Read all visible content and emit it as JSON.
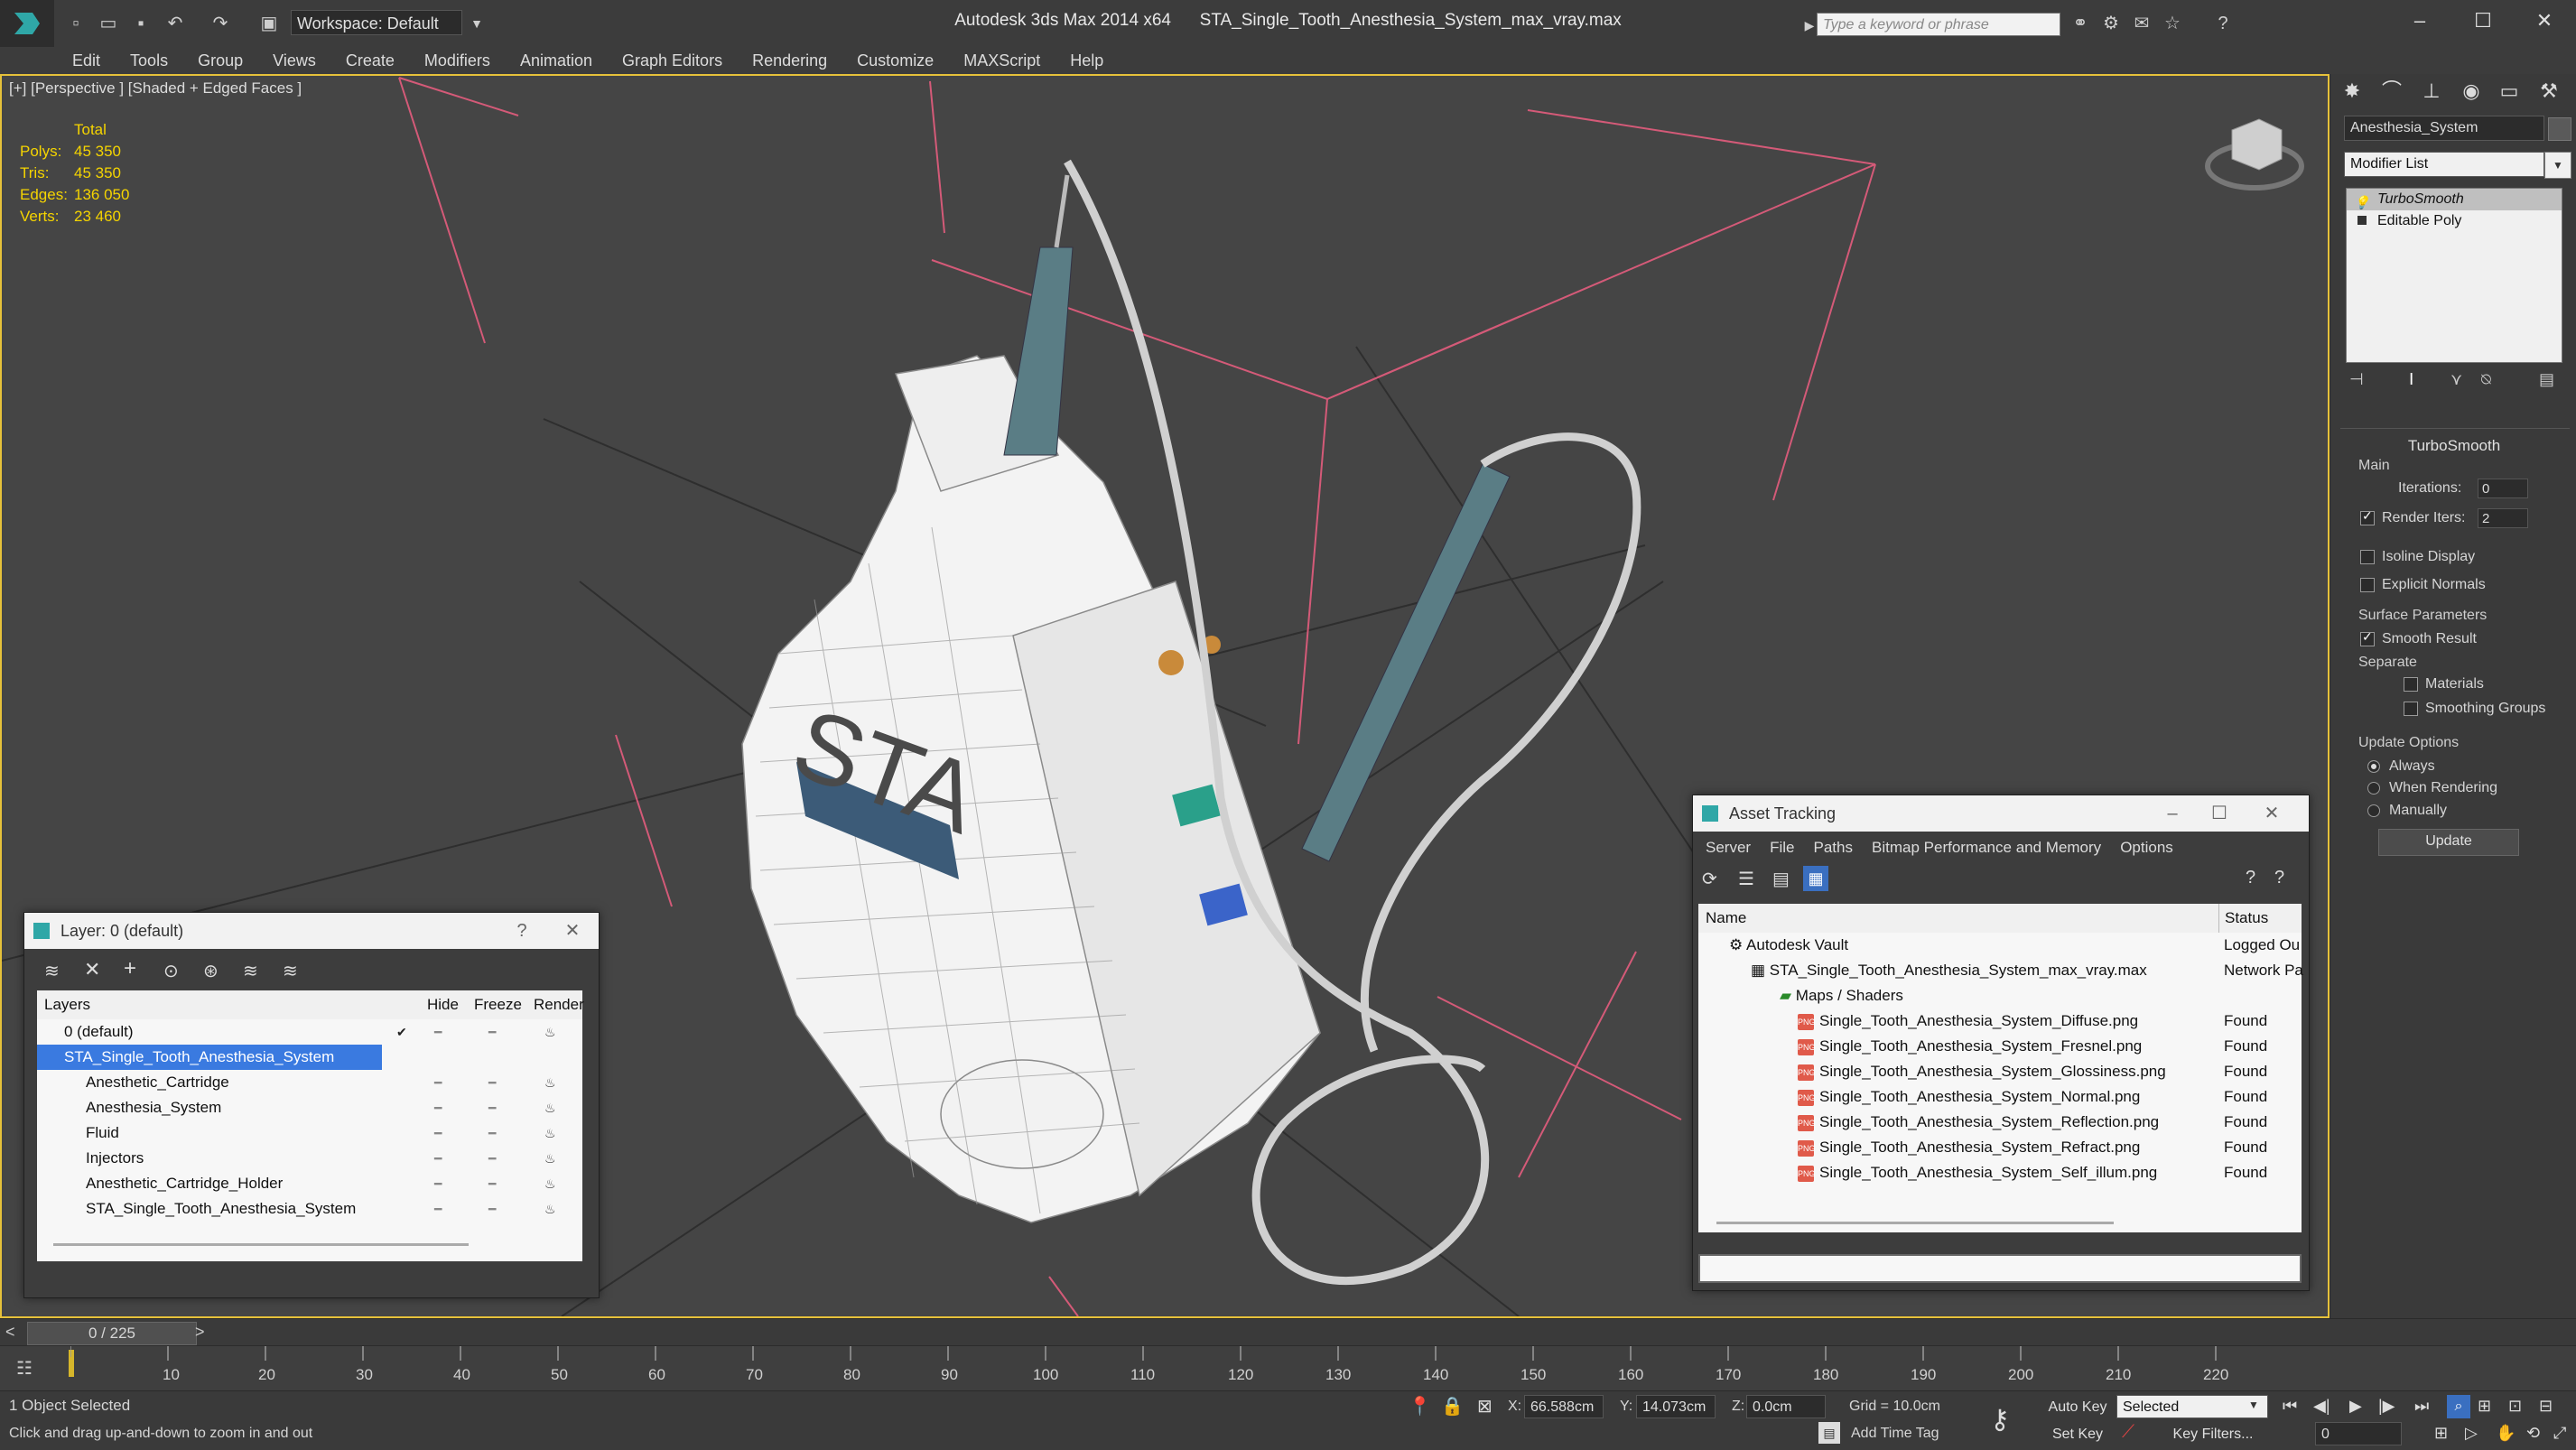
{
  "title_bar": {
    "app_title": "Autodesk 3ds Max  2014 x64",
    "file_name": "STA_Single_Tooth_Anesthesia_System_max_vray.max",
    "workspace": "Workspace: Default",
    "search_placeholder": "Type a keyword or phrase"
  },
  "menu": [
    "Edit",
    "Tools",
    "Group",
    "Views",
    "Create",
    "Modifiers",
    "Animation",
    "Graph Editors",
    "Rendering",
    "Customize",
    "MAXScript",
    "Help"
  ],
  "viewport": {
    "label": "[+] [Perspective ] [Shaded + Edged Faces ]",
    "stats": {
      "header": "Total",
      "rows": [
        {
          "k": "Polys:",
          "v": "45 350"
        },
        {
          "k": "Tris:",
          "v": "45 350"
        },
        {
          "k": "Edges:",
          "v": "136 050"
        },
        {
          "k": "Verts:",
          "v": "23 460"
        }
      ]
    },
    "labels": {
      "sta": "STA"
    }
  },
  "command_panel": {
    "object_name": "Anesthesia_System",
    "modifier_list": "Modifier List",
    "stack": [
      "TurboSmooth",
      "Editable Poly"
    ],
    "rollout_title": "TurboSmooth",
    "main_label": "Main",
    "iterations_label": "Iterations:",
    "iterations_value": "0",
    "render_iters_label": "Render Iters:",
    "render_iters_value": "2",
    "isoline": "Isoline Display",
    "explicit_normals": "Explicit Normals",
    "surface_params": "Surface Parameters",
    "smooth_result": "Smooth Result",
    "separate": "Separate",
    "materials": "Materials",
    "smoothing_groups": "Smoothing Groups",
    "update_options": "Update Options",
    "always": "Always",
    "when_rendering": "When Rendering",
    "manually": "Manually",
    "update_button": "Update"
  },
  "layer_dialog": {
    "title": "Layer: 0 (default)",
    "help": "?",
    "columns": [
      "Layers",
      "Hide",
      "Freeze",
      "Render"
    ],
    "rows": [
      {
        "name": "0 (default)",
        "indent": 1
      },
      {
        "name": "STA_Single_Tooth_Anesthesia_System",
        "indent": 1
      },
      {
        "name": "Anesthetic_Cartridge",
        "indent": 2
      },
      {
        "name": "Anesthesia_System",
        "indent": 2
      },
      {
        "name": "Fluid",
        "indent": 2
      },
      {
        "name": "Injectors",
        "indent": 2
      },
      {
        "name": "Anesthetic_Cartridge_Holder",
        "indent": 2
      },
      {
        "name": "STA_Single_Tooth_Anesthesia_System",
        "indent": 2
      }
    ]
  },
  "asset_dialog": {
    "title": "Asset Tracking",
    "menu": [
      "Server",
      "File",
      "Paths",
      "Bitmap Performance and Memory",
      "Options"
    ],
    "columns": [
      "Name",
      "Status"
    ],
    "rows": [
      {
        "name": "Autodesk Vault",
        "status": "Logged Ou",
        "indent": 1
      },
      {
        "name": "STA_Single_Tooth_Anesthesia_System_max_vray.max",
        "status": "Network Pa",
        "indent": 2
      },
      {
        "name": "Maps / Shaders",
        "status": "",
        "indent": 3
      },
      {
        "name": "Single_Tooth_Anesthesia_System_Diffuse.png",
        "status": "Found",
        "indent": 4
      },
      {
        "name": "Single_Tooth_Anesthesia_System_Fresnel.png",
        "status": "Found",
        "indent": 4
      },
      {
        "name": "Single_Tooth_Anesthesia_System_Glossiness.png",
        "status": "Found",
        "indent": 4
      },
      {
        "name": "Single_Tooth_Anesthesia_System_Normal.png",
        "status": "Found",
        "indent": 4
      },
      {
        "name": "Single_Tooth_Anesthesia_System_Reflection.png",
        "status": "Found",
        "indent": 4
      },
      {
        "name": "Single_Tooth_Anesthesia_System_Refract.png",
        "status": "Found",
        "indent": 4
      },
      {
        "name": "Single_Tooth_Anesthesia_System_Self_illum.png",
        "status": "Found",
        "indent": 4
      }
    ]
  },
  "timeline": {
    "frame_label": "0 / 225",
    "ticks": [
      "10",
      "20",
      "30",
      "40",
      "50",
      "60",
      "70",
      "80",
      "90",
      "100",
      "110",
      "120",
      "130",
      "140",
      "150",
      "160",
      "170",
      "180",
      "190",
      "200",
      "210",
      "220"
    ]
  },
  "status": {
    "selected": "1 Object Selected",
    "prompt": "Click and drag up-and-down to zoom in and out",
    "x_label": "X:",
    "x_value": "66.588cm",
    "y_label": "Y:",
    "y_value": "14.073cm",
    "z_label": "Z:",
    "z_value": "0.0cm",
    "grid": "Grid = 10.0cm",
    "add_time_tag": "Add Time Tag",
    "auto_key": "Auto Key",
    "set_key": "Set Key",
    "selected_dropdown": "Selected",
    "key_filters": "Key Filters...",
    "frame_value": "0"
  },
  "colors": {
    "accent_yellow": "#f5d400",
    "selection_blue": "#3a7ae0",
    "viewport_border": "#e6c13a"
  }
}
